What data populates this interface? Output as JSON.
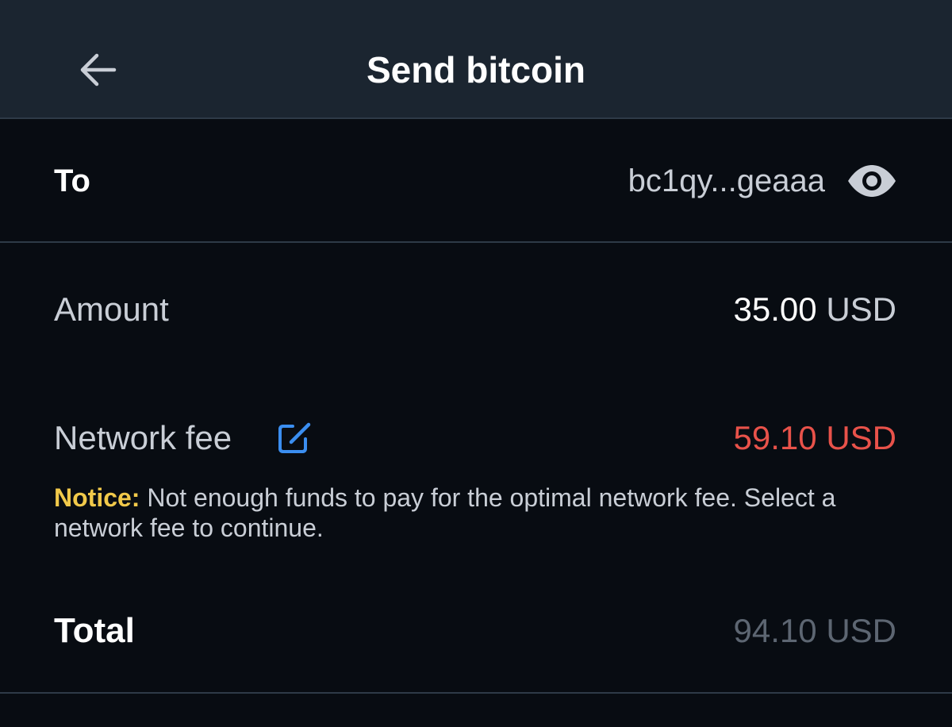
{
  "header": {
    "title": "Send bitcoin",
    "back_icon": "arrow-left-icon"
  },
  "recipient": {
    "label": "To",
    "address": "bc1qy...geaaa",
    "reveal_icon": "eye-icon"
  },
  "amount": {
    "label": "Amount",
    "value": "35.00",
    "unit": "USD"
  },
  "network_fee": {
    "label": "Network fee",
    "edit_icon": "edit-icon",
    "value": "59.10 USD",
    "value_color": "#e8524a"
  },
  "notice": {
    "label": "Notice:",
    "message": " Not enough funds to pay for the optimal network fee. Select a network fee to continue.",
    "label_color": "#f1c94a"
  },
  "total": {
    "label": "Total",
    "value": "94.10 USD"
  },
  "colors": {
    "background": "#080c12",
    "header_background": "#1b2530",
    "divider": "#2e3a47",
    "accent_blue": "#3b8ef0"
  }
}
